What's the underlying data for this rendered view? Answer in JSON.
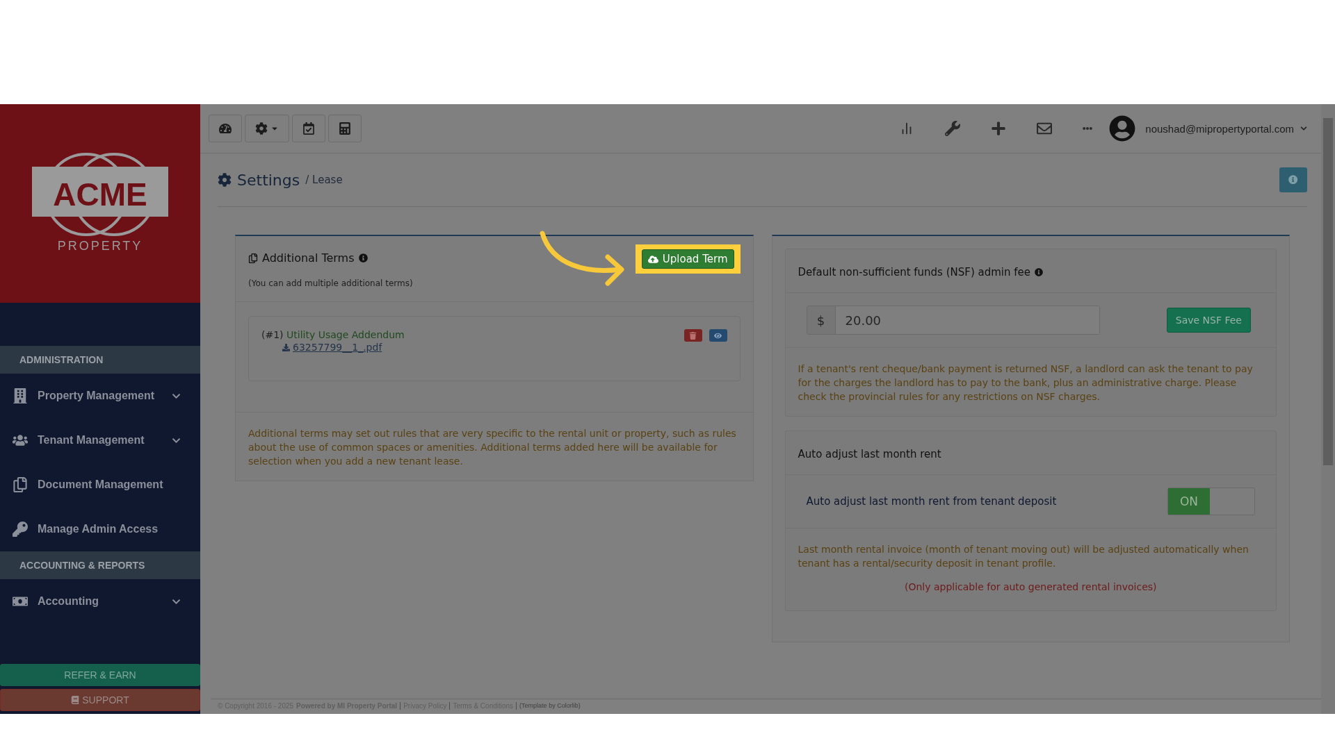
{
  "sidebar": {
    "logo": {
      "word": "ACME",
      "sub": "PROPERTY"
    },
    "items": [
      {
        "kind": "header",
        "label": "ADMINISTRATION"
      },
      {
        "kind": "item",
        "label": "Property Management",
        "expandable": true
      },
      {
        "kind": "item",
        "label": "Tenant Management",
        "expandable": true
      },
      {
        "kind": "item",
        "label": "Document Management",
        "expandable": false
      },
      {
        "kind": "item",
        "label": "Manage Admin Access",
        "expandable": false
      },
      {
        "kind": "header",
        "label": "ACCOUNTING & REPORTS"
      },
      {
        "kind": "item",
        "label": "Accounting",
        "expandable": true
      }
    ],
    "buttons": [
      {
        "kind": "refer",
        "label": "REFER & EARN"
      },
      {
        "kind": "support",
        "label": "SUPPORT"
      }
    ]
  },
  "topbar": {
    "user": "noushad@mipropertyportal.com"
  },
  "breadcrumb": {
    "title": "Settings",
    "path": "/ Lease"
  },
  "additional_terms": {
    "title": "Additional Terms",
    "hint": "(You can add multiple additional terms)",
    "upload_button": "Upload Term",
    "terms": [
      {
        "number": "(#1)",
        "name": "Utility Usage Addendum",
        "file": "63257799__1_.pdf"
      }
    ],
    "note": "Additional terms may set out rules that are very specific to the rental unit or property, such as rules about the use of common spaces or amenities. Additional terms added here will be available for selection when you add a new tenant lease."
  },
  "nsf": {
    "title": "Default non-sufficient funds (NSF) admin fee",
    "currency": "$",
    "value": "20.00",
    "button": "Save NSF Fee",
    "note": "If a tenant's rent cheque/bank payment is returned NSF, a landlord can ask the tenant to pay for the charges the landlord has to pay to the bank, plus an administrative charge. Please check the provincial rules for any restrictions on NSF charges."
  },
  "auto_adjust": {
    "title": "Auto adjust last month rent",
    "label": "Auto adjust last month rent from tenant deposit",
    "toggle_label": "ON",
    "on": true,
    "note": "Last month rental invoice (month of tenant moving out) will be adjusted automatically when tenant has a rental/security deposit in tenant profile.",
    "warning": "(Only applicable for auto generated rental invoices)"
  },
  "footer": {
    "copyright": "© Copyright 2016 - 2025",
    "powered": "Powered by MI Property Portal",
    "links": [
      "Privacy Policy",
      "Terms & Conditions"
    ],
    "credit": "(Template by Colorlib)"
  }
}
